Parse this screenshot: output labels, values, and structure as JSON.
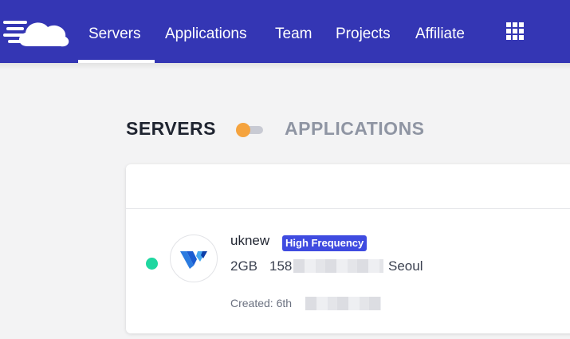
{
  "nav": {
    "items": [
      {
        "label": "Servers",
        "active": true
      },
      {
        "label": "Applications",
        "active": false
      },
      {
        "label": "Team",
        "active": false
      },
      {
        "label": "Projects",
        "active": false
      },
      {
        "label": "Affiliate",
        "active": false
      }
    ],
    "apps_icon": "grid-icon",
    "logo_icon": "cloud-speed-logo"
  },
  "switcher": {
    "left_label": "SERVERS",
    "right_label": "APPLICATIONS",
    "selected": "SERVERS"
  },
  "server": {
    "name": "uknew",
    "badge": "High Frequency",
    "size": "2GB",
    "ip_prefix": "158",
    "location": "Seoul",
    "created_label": "Created: 6th",
    "status": "running",
    "provider_icon": "vultr-logo"
  },
  "colors": {
    "topbar": "#3436b4",
    "toggle_knob": "#f5a33e",
    "status_dot": "#1fd7a0",
    "badge": "#3f4be0"
  }
}
